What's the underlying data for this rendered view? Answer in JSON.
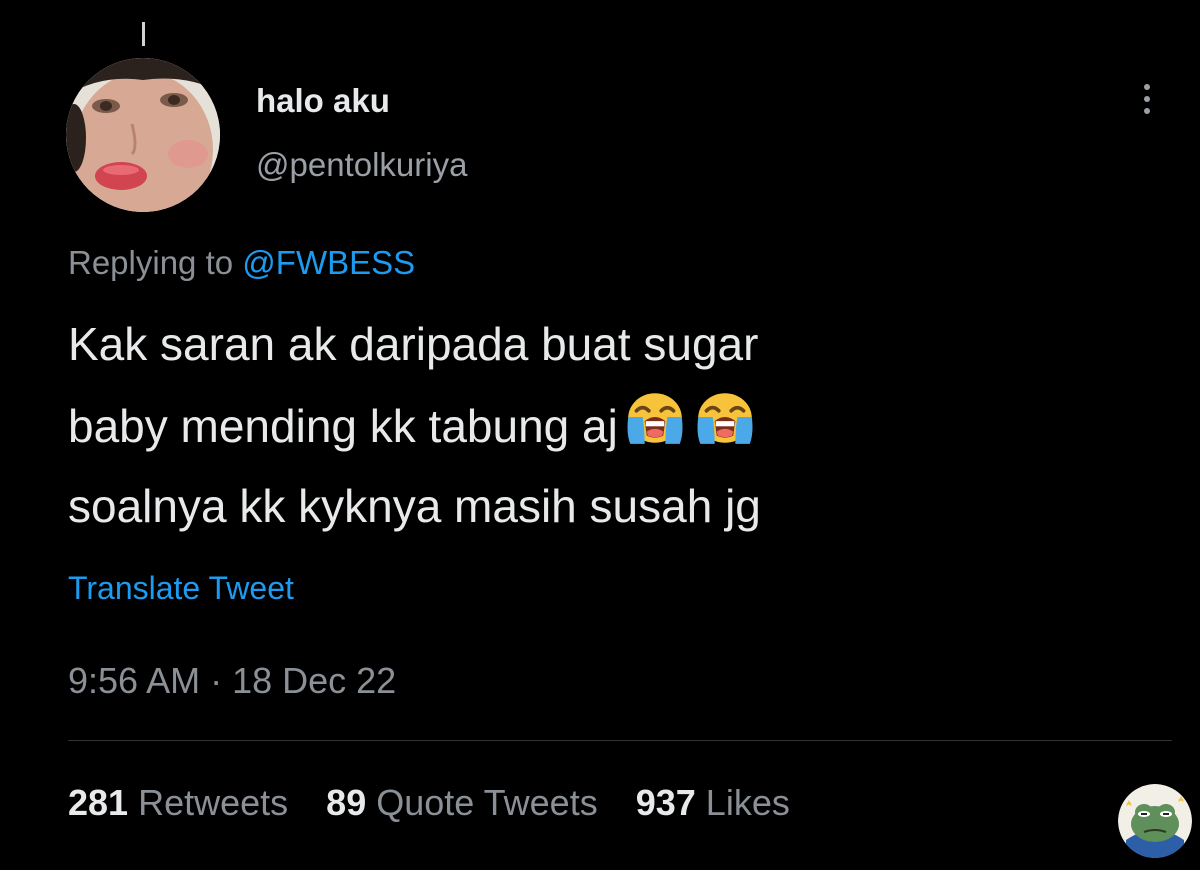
{
  "author": {
    "display_name": "halo aku",
    "handle": "@pentolkuriya"
  },
  "reply": {
    "prefix": "Replying to",
    "mention": "@FWBESS"
  },
  "tweet": {
    "lines": [
      "Kak saran ak daripada buat sugar",
      "baby mending kk tabung aj",
      "soalnya kk kyknya masih susah jg"
    ],
    "emoji": [
      "loudly-crying-face",
      "loudly-crying-face"
    ]
  },
  "translate_label": "Translate Tweet",
  "timestamp": "9:56 AM · 18 Dec 22",
  "stats": {
    "retweets": {
      "count": "281",
      "label": "Retweets"
    },
    "quote_tweets": {
      "count": "89",
      "label": "Quote Tweets"
    },
    "likes": {
      "count": "937",
      "label": "Likes"
    }
  },
  "colors": {
    "background": "#000000",
    "text": "#e7e9ea",
    "secondary": "#8b9096",
    "link": "#1d9bf0"
  },
  "icons": {
    "more": "more-vertical-icon",
    "watermark": "frog-watermark-icon"
  }
}
